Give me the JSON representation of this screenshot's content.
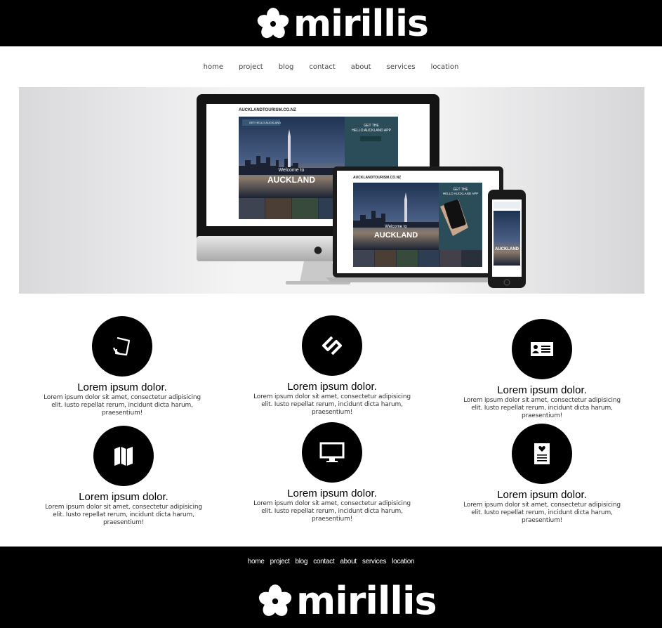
{
  "brand": {
    "name": "mirillis",
    "logo_icon": "flower-icon"
  },
  "nav": {
    "items": [
      {
        "label": "home"
      },
      {
        "label": "project"
      },
      {
        "label": "blog"
      },
      {
        "label": "contact"
      },
      {
        "label": "about"
      },
      {
        "label": "services"
      },
      {
        "label": "location"
      }
    ]
  },
  "hero": {
    "site": "AUCKLANDTOURISM.CO.NZ",
    "welcome": "Welcome to",
    "city": "AUCKLAND",
    "promo_line1": "GET THE",
    "promo_line2": "HELLO AUCKLAND APP",
    "banner": "GET HELLO AUCKLAND"
  },
  "features": [
    {
      "icon": "document-icon",
      "title": "Lorem ipsum dolor.",
      "text": "Lorem ipsum dolor sit amet, consectetur adipisicing elit. Iusto repellat rerum, incidunt dicta harum, praesentium!"
    },
    {
      "icon": "link-icon",
      "title": "Lorem ipsum dolor.",
      "text": "Lorem ipsum dolor sit amet, consectetur adipisicing elit. Iusto repellat rerum, incidunt dicta harum, praesentium!"
    },
    {
      "icon": "id-card-icon",
      "title": "Lorem ipsum dolor.",
      "text": "Lorem ipsum dolor sit amet, consectetur adipisicing elit. Iusto repellat rerum, incidunt dicta harum, praesentium!"
    },
    {
      "icon": "map-icon",
      "title": "Lorem ipsum dolor.",
      "text": "Lorem ipsum dolor sit amet, consectetur adipisicing elit. Iusto repellat rerum, incidunt dicta harum, praesentium!"
    },
    {
      "icon": "monitor-icon",
      "title": "Lorem ipsum dolor.",
      "text": "Lorem ipsum dolor sit amet, consectetur adipisicing elit. Iusto repellat rerum, incidunt dicta harum, praesentium!"
    },
    {
      "icon": "heart-page-icon",
      "title": "Lorem ipsum dolor.",
      "text": "Lorem ipsum dolor sit amet, consectetur adipisicing elit. Iusto repellat rerum, incidunt dicta harum, praesentium!"
    }
  ],
  "footer": {
    "nav": [
      {
        "label": "home"
      },
      {
        "label": "project"
      },
      {
        "label": "blog"
      },
      {
        "label": "contact"
      },
      {
        "label": "about"
      },
      {
        "label": "services"
      },
      {
        "label": "location"
      }
    ]
  },
  "colors": {
    "header_bg": "#000000",
    "page_bg": "#ffffff",
    "icon_circle": "#000000",
    "nav_text": "#444444"
  }
}
